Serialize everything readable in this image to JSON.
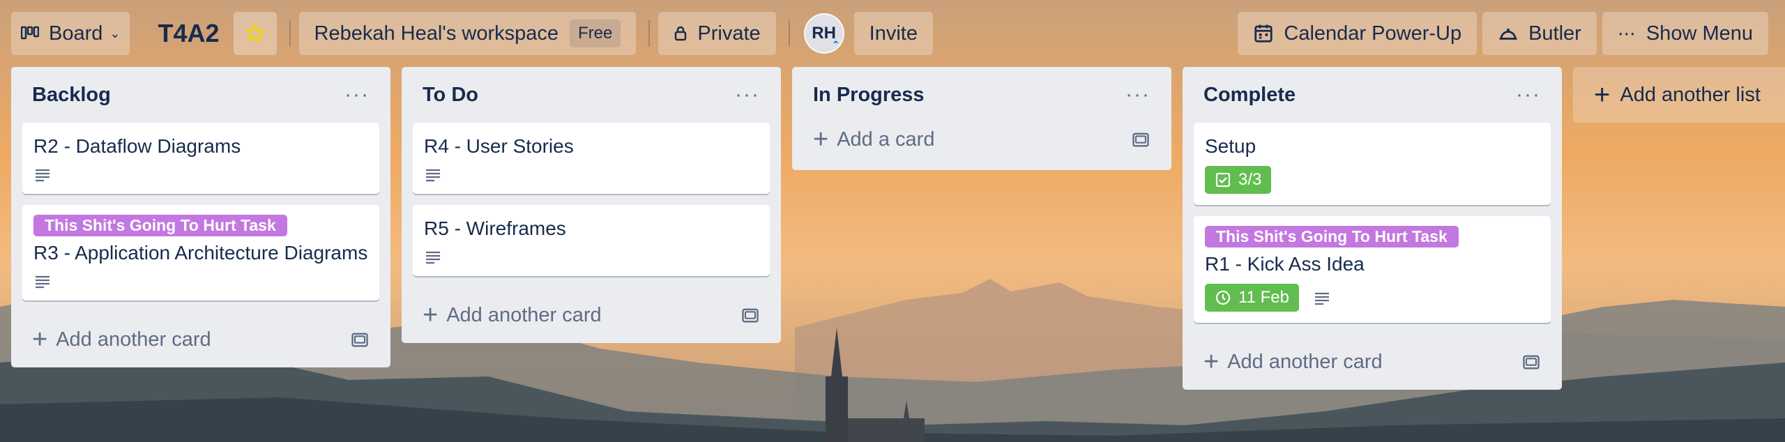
{
  "header": {
    "board_switcher_label": "Board",
    "board_title": "T4A2",
    "workspace_name": "Rebekah Heal's workspace",
    "workspace_plan": "Free",
    "visibility": "Private",
    "member_initials": "RH",
    "invite_label": "Invite",
    "calendar_label": "Calendar Power-Up",
    "butler_label": "Butler",
    "show_menu_label": "Show Menu"
  },
  "lists": [
    {
      "title": "Backlog",
      "cards": [
        {
          "title": "R2 - Dataflow Diagrams"
        },
        {
          "label": "This Shit's Going To Hurt Task",
          "title": "R3 - Application Architecture Diagrams"
        }
      ],
      "add_label": "Add another card"
    },
    {
      "title": "To Do",
      "cards": [
        {
          "title": "R4 - User Stories"
        },
        {
          "title": "R5 - Wireframes"
        }
      ],
      "add_label": "Add another card"
    },
    {
      "title": "In Progress",
      "cards": [],
      "add_label": "Add a card"
    },
    {
      "title": "Complete",
      "cards": [
        {
          "title": "Setup",
          "checklist": "3/3"
        },
        {
          "label": "This Shit's Going To Hurt Task",
          "title": "R1 - Kick Ass Idea",
          "due": "11 Feb"
        }
      ],
      "add_label": "Add another card"
    }
  ],
  "add_list_label": "Add another list",
  "colors": {
    "label_purple": "#c377e0",
    "badge_green": "#61bd4f",
    "list_bg": "#ebecf0",
    "text": "#172b4d"
  }
}
